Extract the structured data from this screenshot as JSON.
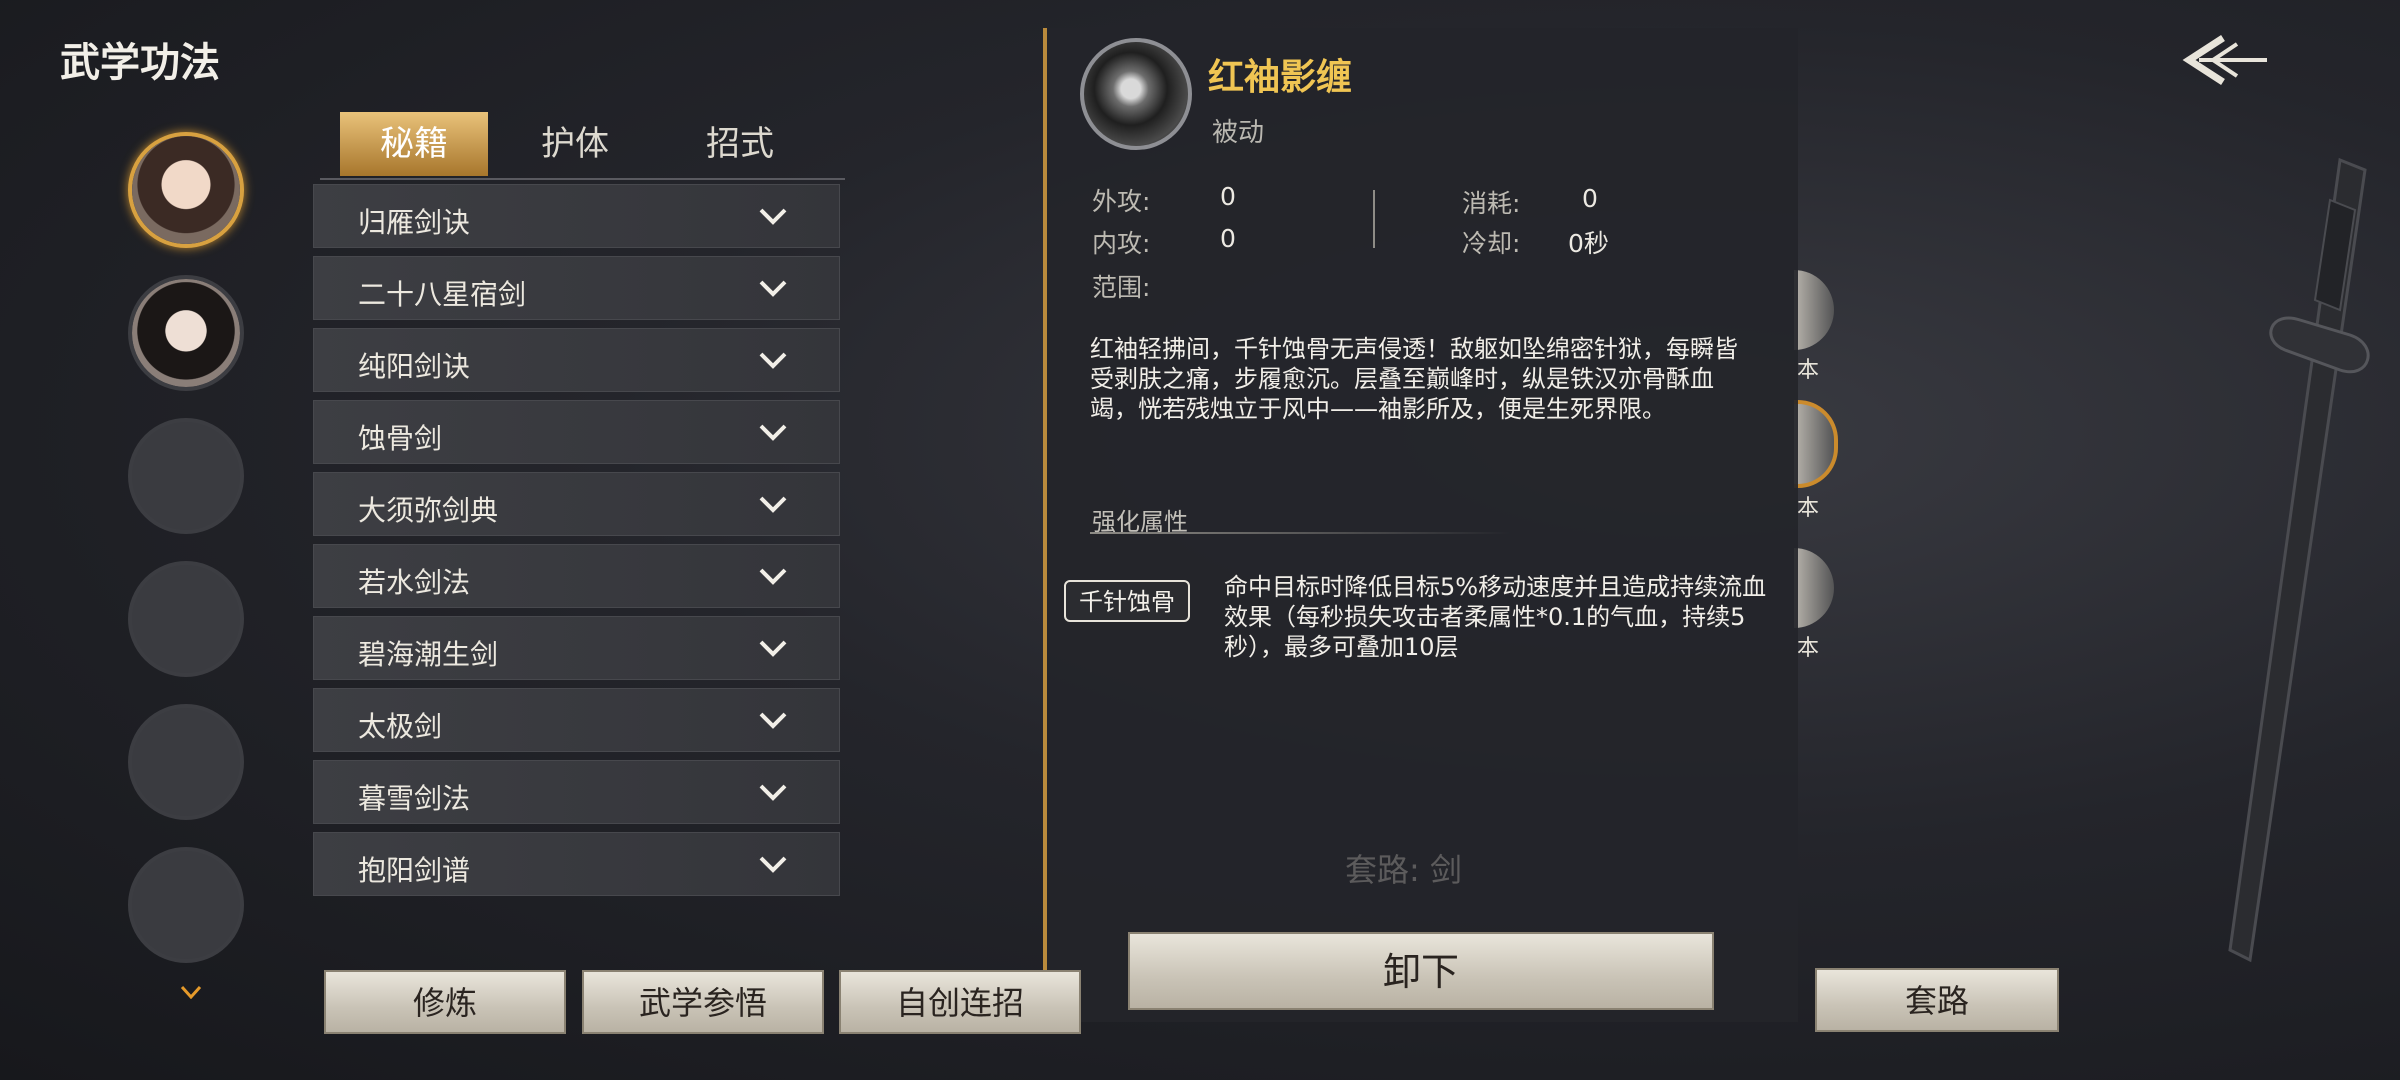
{
  "header": {
    "title": "武学功法"
  },
  "tabs": [
    {
      "label": "秘籍",
      "active": true
    },
    {
      "label": "护体",
      "active": false
    },
    {
      "label": "招式",
      "active": false
    }
  ],
  "skill_list": [
    {
      "label": "归雁剑诀"
    },
    {
      "label": "二十八星宿剑"
    },
    {
      "label": "纯阳剑诀"
    },
    {
      "label": "蚀骨剑"
    },
    {
      "label": "大须弥剑典"
    },
    {
      "label": "若水剑法"
    },
    {
      "label": "碧海潮生剑"
    },
    {
      "label": "太极剑"
    },
    {
      "label": "暮雪剑法"
    },
    {
      "label": "抱阳剑谱"
    }
  ],
  "detail": {
    "name": "红袖影缠",
    "type": "被动",
    "stats": {
      "waigong_label": "外攻:",
      "waigong_value": "0",
      "neigong_label": "内攻:",
      "neigong_value": "0",
      "xiaohao_label": "消耗:",
      "xiaohao_value": "0",
      "lengque_label": "冷却:",
      "lengque_value": "0秒",
      "fanwei_label": "范围:"
    },
    "description": "红袖轻拂间，千针蚀骨无声侵透！敌躯如坠绵密针狱，每瞬皆受剥肤之痛，步履愈沉。层叠至巅峰时，纵是铁汉亦骨酥血竭，恍若残烛立于风中——袖影所及，便是生死界限。",
    "section_title": "强化属性",
    "effect_tag": "千针蚀骨",
    "effect_text": "命中目标时降低目标5%移动速度并且造成持续流血效果（每秒损失攻击者柔属性*0.1的气血，持续5秒），最多可叠加10层",
    "ghost_text": "套路: 剑"
  },
  "buttons": {
    "xiulian": "修炼",
    "canwu": "武学参悟",
    "zichuang": "自创连招",
    "unequip": "卸下",
    "taolu": "套路"
  },
  "side_slot_labels": [
    "本",
    "本",
    "本"
  ],
  "colors": {
    "accent_gold": "#f0c553",
    "tab_active": "#c9963f",
    "avatar_ring": "#d8a140"
  },
  "icons": {
    "back": "back-arrow-icon",
    "chevron": "chevron-down-icon"
  }
}
